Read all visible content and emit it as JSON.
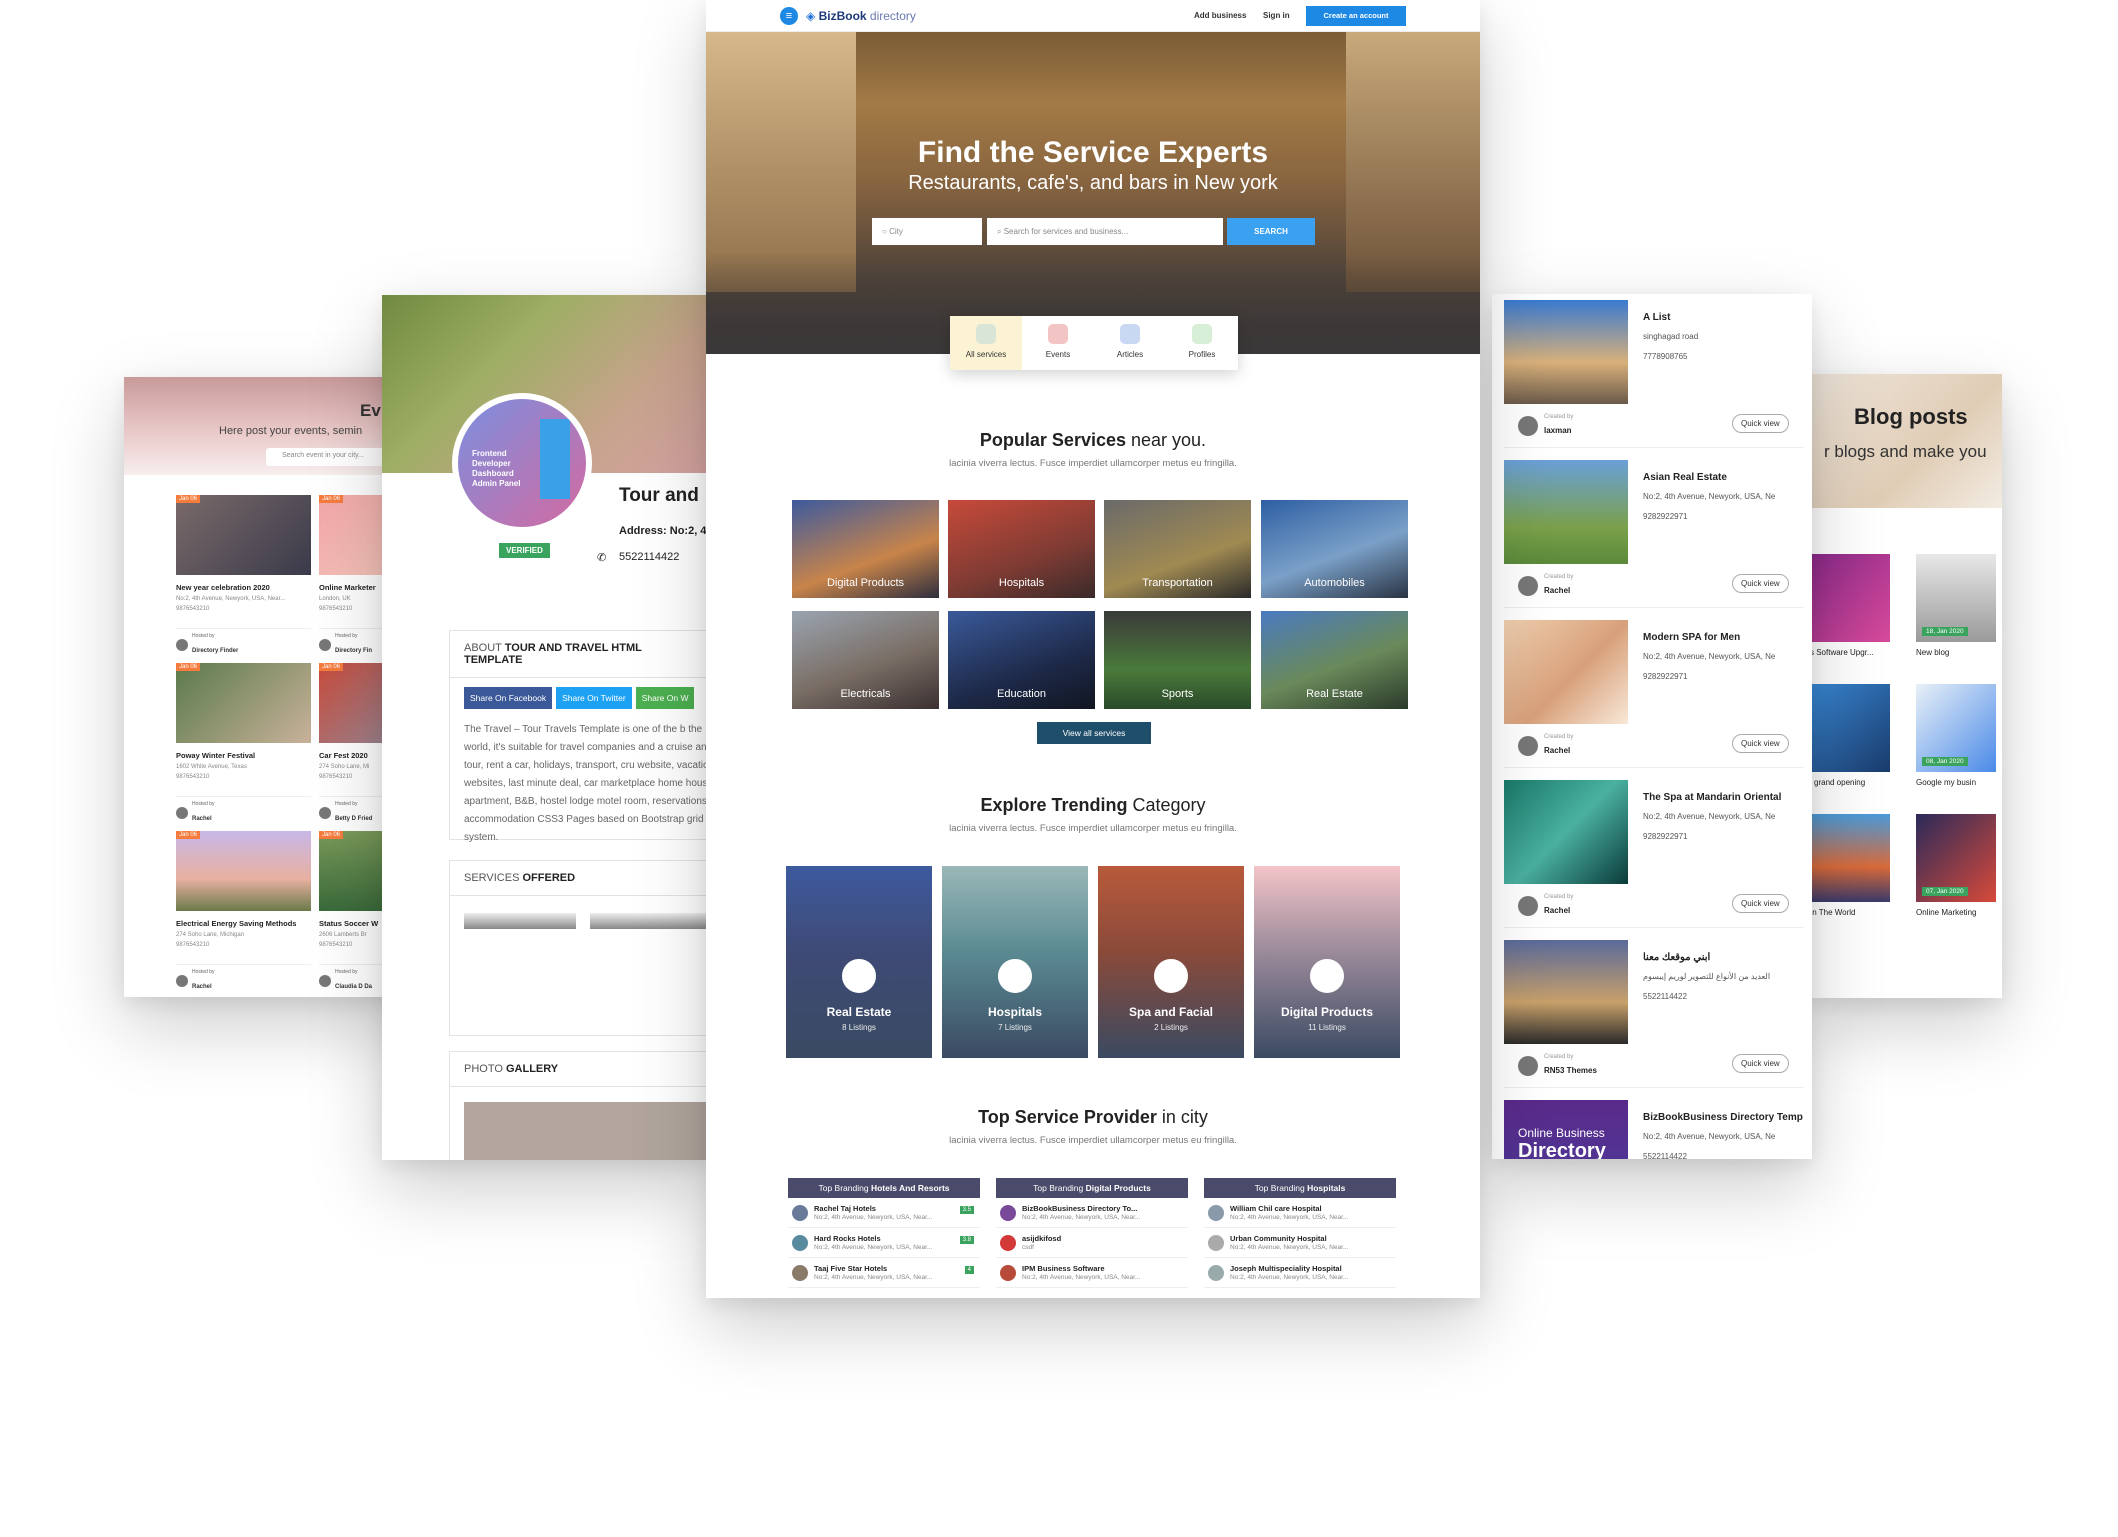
{
  "events_page": {
    "title": "Ev",
    "subtitle": "Here post your events, semin",
    "search_placeholder": "Search event in your city...",
    "events": [
      {
        "tag": "Jan 06",
        "title": "New year celebration 2020",
        "location": "No:2, 4th Avenue, Newyork, USA, Near...",
        "phone": "9876543210",
        "by_label": "Hosted by",
        "by": "Directory Finder"
      },
      {
        "tag": "Jan 06",
        "title": "Online Marketer",
        "location": "London, UK",
        "phone": "9876543210",
        "by_label": "Hosted by",
        "by": "Directory Fin"
      },
      {
        "tag": "Jan 06",
        "title": "Poway Winter Festival",
        "location": "1602 White Avenue, Texas",
        "phone": "9876543210",
        "by_label": "Hosted by",
        "by": "Rachel"
      },
      {
        "tag": "Jan 06",
        "title": "Car Fest 2020",
        "location": "274 Soho Lane, Mi",
        "phone": "9876543210",
        "by_label": "Hosted by",
        "by": "Betty D Fried"
      },
      {
        "tag": "Jan 06",
        "title": "Electrical Energy Saving Methods",
        "location": "274 Soho Lane, Michigan",
        "phone": "9876543210",
        "by_label": "Hosted by",
        "by": "Rachel"
      },
      {
        "tag": "Jan 06",
        "title": "Status Soccer W",
        "location": "2606 Lamberts Br",
        "phone": "9876543210",
        "by_label": "Hosted by",
        "by": "Claudia D Da"
      }
    ]
  },
  "profile_page": {
    "name": "Tour and",
    "verified": "VERIFIED",
    "address_label": "Address:",
    "address": "No:2, 4t",
    "phone": "5522114422",
    "about_title_prefix": "ABOUT ",
    "about_title": "TOUR AND TRAVEL HTML TEMPLATE",
    "share": [
      "Share On Facebook",
      "Share On Twitter",
      "Share On W"
    ],
    "about_text": "The Travel – Tour Travels Template is one of the b the world, it's suitable for travel companies and a cruise and tour, rent a car, holidays, transport, cru website, vacations websites, last minute deal, car marketplace home houses apartment, B&B, hostel lodge motel room, reservations, accommodation CSS3 Pages based on Bootstrap grid system.",
    "services_prefix": "SERVICES ",
    "services_title": "OFFERED",
    "gallery_prefix": "PHOTO ",
    "gallery_title": "GALLERY",
    "avatar_text": "Frontend Developer Dashboard Admin Panel"
  },
  "main_page": {
    "logo_bold": "BizBook",
    "logo_light": " directory",
    "nav": {
      "add_business": "Add business",
      "sign_in": "Sign in",
      "create_account": "Create an account"
    },
    "hero_title": "Find the Service Experts",
    "hero_subtitle": "Restaurants, cafe's, and bars in New york",
    "city_placeholder": "City",
    "search_placeholder": "Search for services and business...",
    "search_button": "SEARCH",
    "categories": [
      {
        "label": "All services",
        "icon": "target-icon"
      },
      {
        "label": "Events",
        "icon": "flag-icon"
      },
      {
        "label": "Articles",
        "icon": "chat-icon"
      },
      {
        "label": "Profiles",
        "icon": "user-icon"
      }
    ],
    "popular_bold": "Popular Services",
    "popular_rest": " near you.",
    "section_sub": "lacinia viverra lectus. Fusce imperdiet ullamcorper metus eu fringilla.",
    "services": [
      "Digital Products",
      "Hospitals",
      "Transportation",
      "Automobiles",
      "Electricals",
      "Education",
      "Sports",
      "Real Estate"
    ],
    "view_all": "View all services",
    "trending_bold": "Explore Trending",
    "trending_rest": " Category",
    "trending": [
      {
        "name": "Real Estate",
        "count": "8 Listings"
      },
      {
        "name": "Hospitals",
        "count": "7 Listings"
      },
      {
        "name": "Spa and Facial",
        "count": "2 Listings"
      },
      {
        "name": "Digital Products",
        "count": "11 Listings"
      }
    ],
    "provider_bold": "Top Service Provider",
    "provider_rest": " in city",
    "providers": [
      {
        "head_prefix": "Top Branding ",
        "head": "Hotels And Resorts",
        "rows": [
          {
            "name": "Rachel Taj Hotels",
            "addr": "No:2, 4th Avenue, Newyork, USA, Near...",
            "rating": "3.5"
          },
          {
            "name": "Hard Rocks Hotels",
            "addr": "No:2, 4th Avenue, Newyork, USA, Near...",
            "rating": "3.8"
          },
          {
            "name": "Taaj Five Star Hotels",
            "addr": "No:2, 4th Avenue, Newyork, USA, Near...",
            "rating": "4"
          }
        ]
      },
      {
        "head_prefix": "Top Branding ",
        "head": "Digital Products",
        "rows": [
          {
            "name": "BizBookBusiness Directory To...",
            "addr": "No:2, 4th Avenue, Newyork, USA, Near...",
            "rating": ""
          },
          {
            "name": "asijdkifosd",
            "addr": "csdf",
            "rating": ""
          },
          {
            "name": "IPM Business Software",
            "addr": "No:2, 4th Avenue, Newyork, USA, Near...",
            "rating": ""
          }
        ]
      },
      {
        "head_prefix": "Top Branding ",
        "head": "Hospitals",
        "rows": [
          {
            "name": "William Chil care Hospital",
            "addr": "No:2, 4th Avenue, Newyork, USA, Near...",
            "rating": ""
          },
          {
            "name": "Urban Community Hospital",
            "addr": "No:2, 4th Avenue, Newyork, USA, Near...",
            "rating": ""
          },
          {
            "name": "Joseph Multispeciality Hospital",
            "addr": "No:2, 4th Avenue, Newyork, USA, Near...",
            "rating": ""
          }
        ]
      }
    ]
  },
  "listing_page": {
    "created_label": "Created by",
    "quick_view": "Quick view",
    "items": [
      {
        "title": "A List",
        "addr": "singhagad road",
        "phone": "7778908765",
        "by": "laxman"
      },
      {
        "title": "Asian Real Estate",
        "addr": "No:2, 4th Avenue, Newyork, USA, Ne",
        "phone": "9282922971",
        "by": "Rachel"
      },
      {
        "title": "Modern SPA for Men",
        "addr": "No:2, 4th Avenue, Newyork, USA, Ne",
        "phone": "9282922971",
        "by": "Rachel"
      },
      {
        "title": "The Spa at Mandarin Oriental",
        "addr": "No:2, 4th Avenue, Newyork, USA, Ne",
        "phone": "9282922971",
        "by": "Rachel"
      },
      {
        "title": "ابني موقعك معنا",
        "addr": "العديد من الأنواع للتصوير لوريم إيبسوم",
        "phone": "5522114422",
        "by": "RN53 Themes"
      },
      {
        "title": "BizBookBusiness Directory Temp",
        "addr": "No:2, 4th Avenue, Newyork, USA, Ne",
        "phone": "5522114422",
        "by": ""
      }
    ],
    "promo_line1": "Online Business",
    "promo_line2": "Directory"
  },
  "blog_page": {
    "title": "Blog posts",
    "subtitle": "r blogs and make you",
    "posts": [
      {
        "title": "s Software Upgr...",
        "date": ""
      },
      {
        "title": "New blog",
        "date": "18, Jan 2020"
      },
      {
        "title": "l grand opening",
        "date": ""
      },
      {
        "title": "Google my busin",
        "date": "08, Jan 2020"
      },
      {
        "title": "In The World",
        "date": ""
      },
      {
        "title": "Online Marketing",
        "date": "07, Jan 2020"
      }
    ]
  }
}
